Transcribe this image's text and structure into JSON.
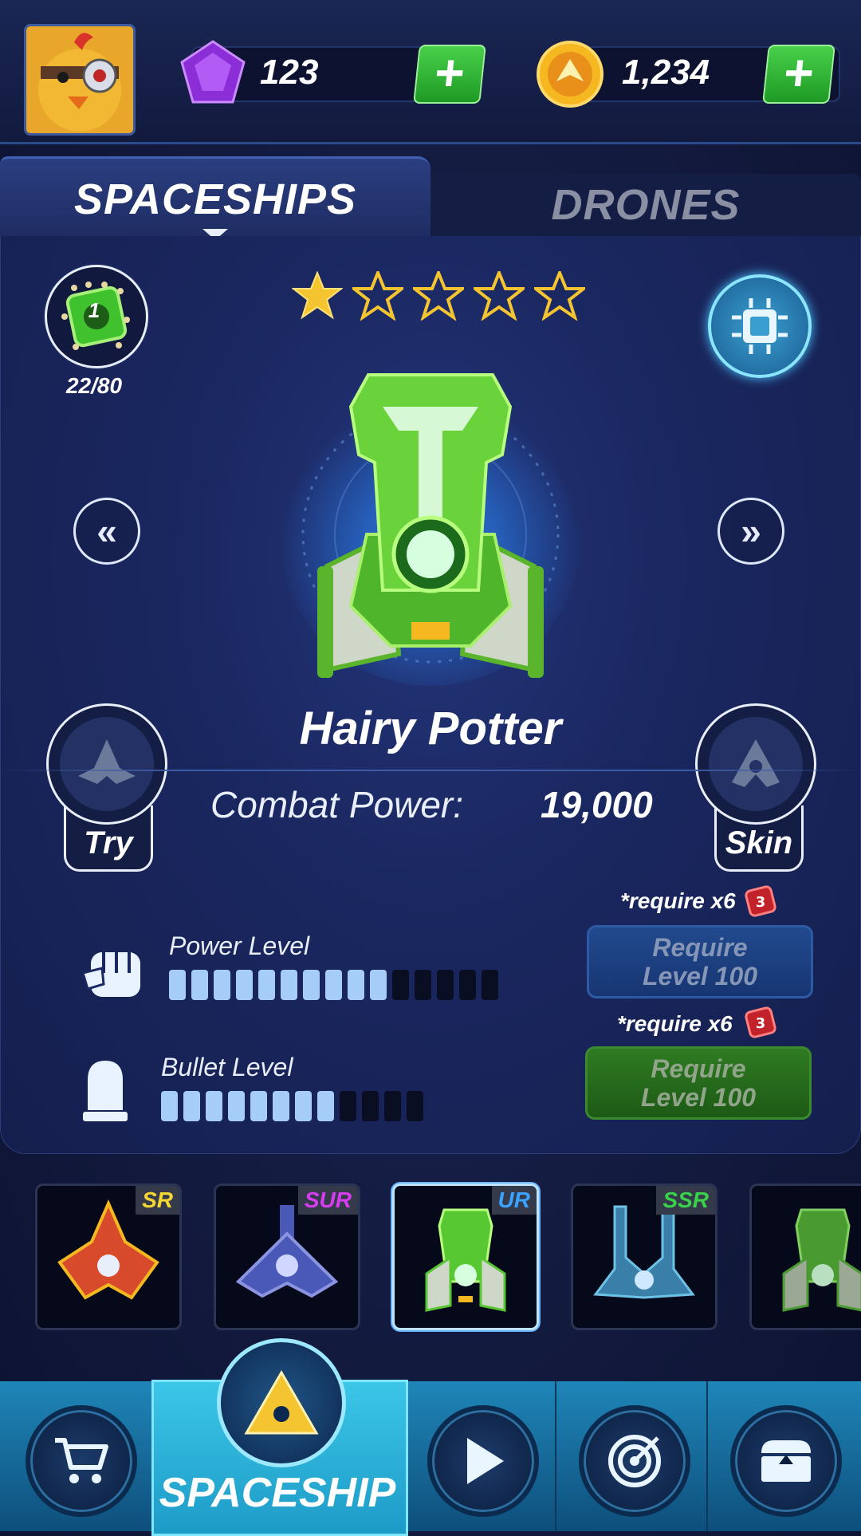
{
  "currency": {
    "gems": "123",
    "coins": "1,234"
  },
  "tabs": {
    "spaceships": "SPACESHIPS",
    "drones": "DRONES"
  },
  "ship": {
    "stars_filled": 1,
    "stars_total": 5,
    "part_count_badge": "1",
    "part_progress": "22/80",
    "name": "Hairy Potter",
    "combat_power_label": "Combat Power:",
    "combat_power_value": "19,000",
    "try_label": "Try",
    "skin_label": "Skin"
  },
  "upgrades": {
    "power": {
      "label": "Power Level",
      "filled": 10,
      "total": 15,
      "require_note": "*require x6",
      "token_count": "3",
      "button_line1": "Require",
      "button_line2": "Level 100"
    },
    "bullet": {
      "label": "Bullet Level",
      "filled": 8,
      "total": 12,
      "require_note": "*require x6",
      "token_count": "3",
      "button_line1": "Require",
      "button_line2": "Level 100"
    }
  },
  "carousel": [
    {
      "rarity": "SR",
      "rarity_color": "#f5d633",
      "ship_color": "#d84a2c"
    },
    {
      "rarity": "SUR",
      "rarity_color": "#d83cf0",
      "ship_color": "#4a58b8"
    },
    {
      "rarity": "UR",
      "rarity_color": "#3aa2ff",
      "ship_color": "#58c832",
      "selected": true
    },
    {
      "rarity": "SSR",
      "rarity_color": "#3ad24a",
      "ship_color": "#3a7fa8"
    },
    {
      "rarity": "",
      "rarity_color": "#ffffff",
      "ship_color": "#4a9a32"
    }
  ],
  "bottom_nav": {
    "active_label": "SPACESHIP",
    "items": [
      "shop-icon",
      "spaceship-icon",
      "play-icon",
      "target-icon",
      "chest-icon"
    ]
  },
  "colors": {
    "accent_green": "#34b736",
    "bar_on": "#a6cdf8",
    "star_gold": "#f5c531"
  }
}
